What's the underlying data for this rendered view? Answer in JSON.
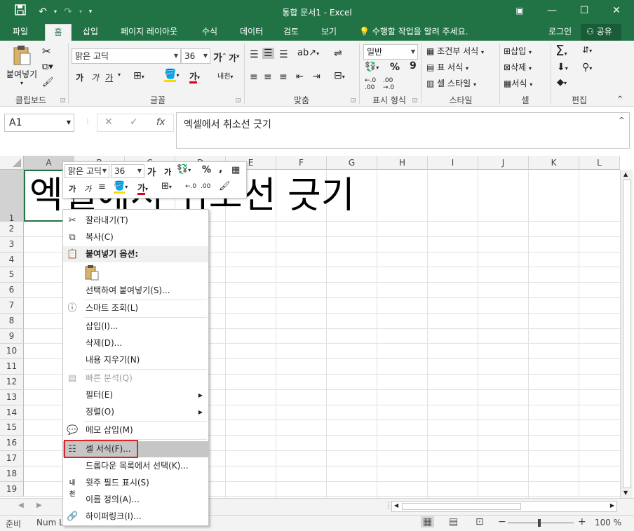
{
  "window": {
    "title": "통합 문서1 - Excel",
    "colors": {
      "brand": "#217346",
      "highlight_box": "#d6262c"
    }
  },
  "qat": {
    "save_icon": "save-icon",
    "undo_icon": "undo-icon",
    "redo_icon": "redo-icon",
    "customize_icon": "chevron-down-icon"
  },
  "tabs": [
    {
      "label": "파일"
    },
    {
      "label": "홈",
      "active": true
    },
    {
      "label": "삽입"
    },
    {
      "label": "페이지 레이아웃"
    },
    {
      "label": "수식"
    },
    {
      "label": "데이터"
    },
    {
      "label": "검토"
    },
    {
      "label": "보기"
    }
  ],
  "tell_me": "수행할 작업을 알려 주세요.",
  "signin": "로그인",
  "share": "공유",
  "ribbon": {
    "clipboard": {
      "label": "클립보드",
      "paste": "붙여넣기"
    },
    "font": {
      "label": "글꼴",
      "font_name": "맑은 고딕",
      "font_size": "36",
      "bold": "가",
      "italic": "가",
      "underline": "가",
      "font_color": "가",
      "phonetic": "내천"
    },
    "alignment": {
      "label": "맞춤"
    },
    "number": {
      "label": "표시 형식",
      "format": "일반",
      "percent": "%",
      "comma": "9"
    },
    "styles": {
      "label": "스타일",
      "conditional": "조건부 서식",
      "table": "표 서식",
      "cell_styles": "셀 스타일"
    },
    "cells": {
      "label": "셀",
      "insert": "삽입",
      "delete": "삭제",
      "format": "서식"
    },
    "editing": {
      "label": "편집"
    }
  },
  "formula_bar": {
    "name_box": "A1",
    "fx": "fx",
    "content": "엑셀에서 취소선 긋기"
  },
  "grid": {
    "columns": [
      "A",
      "B",
      "C",
      "D",
      "E",
      "F",
      "G",
      "H",
      "I",
      "J",
      "K",
      "L"
    ],
    "rows": [
      "1",
      "2",
      "3",
      "4",
      "5",
      "6",
      "7",
      "8",
      "9",
      "10",
      "11",
      "12",
      "13",
      "14",
      "15",
      "16",
      "17",
      "18",
      "19"
    ],
    "a1_text": "엑셀에서 취소선 긋기"
  },
  "mini_toolbar": {
    "font_name": "맑은 고딕",
    "font_size": "36",
    "increase_font": "가",
    "decrease_font": "가",
    "percent": "%",
    "comma": ",",
    "bold": "가",
    "italic": "가",
    "font_color": "가",
    "inc_decimal": ".0",
    "dec_decimal": ".00"
  },
  "context_menu": {
    "items": [
      {
        "label": "잘라내기(T)",
        "icon": "scissors-icon"
      },
      {
        "label": "복사(C)",
        "icon": "copy-icon"
      },
      {
        "label": "붙여넣기 옵션:",
        "icon": "paste-icon",
        "header": true
      },
      {
        "label": "선택하여 붙여넣기(S)...",
        "icon": ""
      },
      {
        "label": "스마트 조회(L)",
        "icon": "smart-lookup-icon"
      },
      {
        "label": "삽입(I)...",
        "icon": ""
      },
      {
        "label": "삭제(D)...",
        "icon": ""
      },
      {
        "label": "내용 지우기(N)",
        "icon": ""
      },
      {
        "label": "빠른 분석(Q)",
        "icon": "quick-analysis-icon",
        "disabled": true
      },
      {
        "label": "필터(E)",
        "icon": "",
        "submenu": true
      },
      {
        "label": "정렬(O)",
        "icon": "",
        "submenu": true
      },
      {
        "label": "메모 삽입(M)",
        "icon": "comment-icon"
      },
      {
        "label": "셀 서식(F)...",
        "icon": "format-cells-icon",
        "highlighted": true
      },
      {
        "label": "드롭다운 목록에서 선택(K)...",
        "icon": ""
      },
      {
        "label": "윗주 필드 표시(S)",
        "icon": "phonetic-icon"
      },
      {
        "label": "이름 정의(A)...",
        "icon": ""
      },
      {
        "label": "하이퍼링크(I)...",
        "icon": "hyperlink-icon"
      }
    ]
  },
  "status": {
    "ready": "준비",
    "numlock": "Num L",
    "zoom": "100 %"
  }
}
